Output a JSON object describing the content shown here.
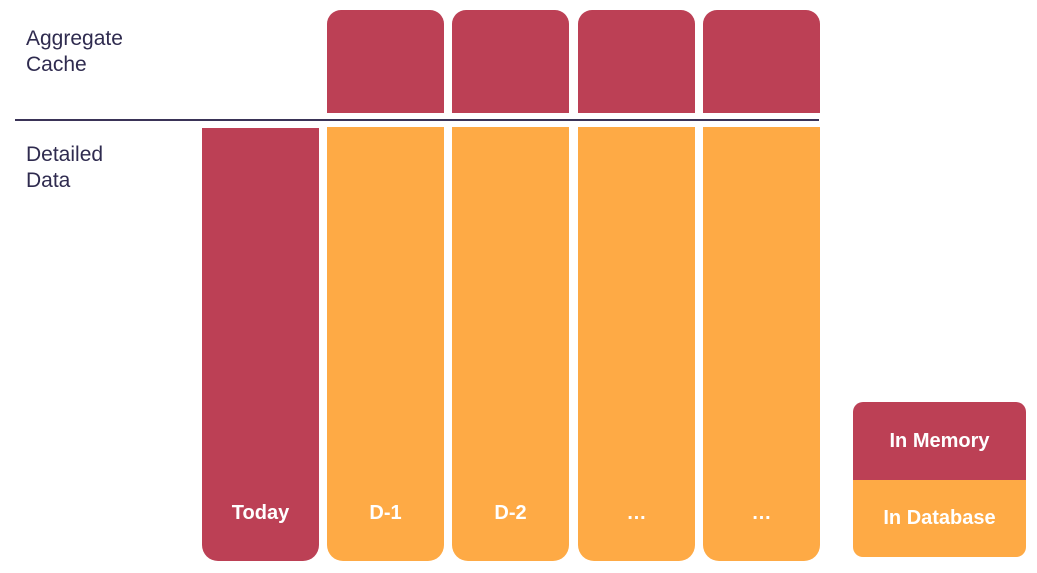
{
  "colors": {
    "in_memory": "#BC4055",
    "in_database": "#FEAA45",
    "text": "#2f2b4f",
    "divider": "#3a3357"
  },
  "labels": {
    "aggregate_cache": "Aggregate\nCache",
    "detailed_data": "Detailed\nData"
  },
  "aggregate_cache": [
    {
      "status": "in_memory"
    },
    {
      "status": "in_memory"
    },
    {
      "status": "in_memory"
    },
    {
      "status": "in_memory"
    }
  ],
  "detailed_data": [
    {
      "label": "Today",
      "status": "in_memory"
    },
    {
      "label": "D-1",
      "status": "in_database"
    },
    {
      "label": "D-2",
      "status": "in_database"
    },
    {
      "label": "…",
      "status": "in_database"
    },
    {
      "label": "…",
      "status": "in_database"
    }
  ],
  "legend": {
    "in_memory": "In Memory",
    "in_database": "In Database"
  }
}
